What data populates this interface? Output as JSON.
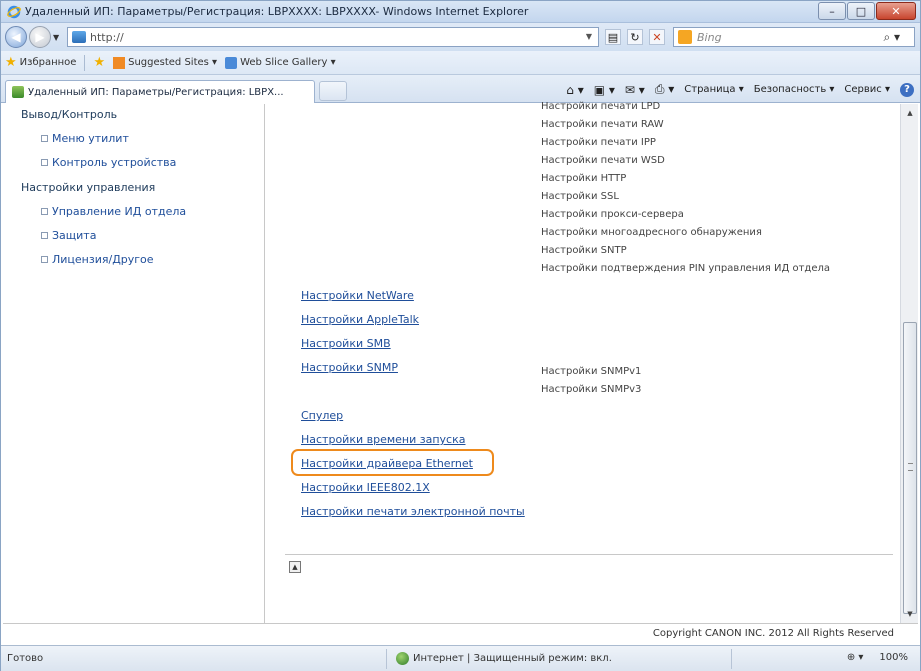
{
  "window": {
    "title": "Удаленный ИП: Параметры/Регистрация: LBPXXXX: LBPXXXX- Windows Internet Explorer",
    "min_label": "–",
    "max_label": "□",
    "close_label": "✕"
  },
  "address": {
    "url": "http://",
    "search_placeholder": "Bing"
  },
  "favorites": {
    "label": "Избранное",
    "items": [
      "Suggested Sites ▾",
      "Web Slice Gallery ▾"
    ]
  },
  "tab": {
    "title": "Удаленный ИП: Параметры/Регистрация: LBPX..."
  },
  "commandbar": {
    "page": "Страница ▾",
    "safety": "Безопасность ▾",
    "tools": "Сервис ▾"
  },
  "sidebar": {
    "section1": "Вывод/Контроль",
    "items1": [
      "Меню утилит",
      "Контроль устройства"
    ],
    "section2": "Настройки управления",
    "items2": [
      "Управление ИД отдела",
      "Защита",
      "Лицензия/Другое"
    ]
  },
  "main": {
    "sub_top": [
      "Настройки печати LPD",
      "Настройки печати RAW",
      "Настройки печати IPP",
      "Настройки печати WSD",
      "Настройки HTTP",
      "Настройки SSL",
      "Настройки прокси-сервера",
      "Настройки многоадресного обнаружения",
      "Настройки SNTP",
      "Настройки подтверждения PIN управления ИД отдела"
    ],
    "links": [
      "Настройки NetWare",
      "Настройки AppleTalk",
      "Настройки SMB",
      "Настройки SNMP",
      "Спулер",
      "Настройки времени запуска",
      "Настройки драйвера Ethernet",
      "Настройки IEEE802.1X",
      "Настройки печати электронной почты"
    ],
    "snmp_sub": [
      "Настройки SNMPv1",
      "Настройки SNMPv3"
    ],
    "copyright": "Copyright CANON INC. 2012 All Rights Reserved"
  },
  "status": {
    "ready": "Готово",
    "zone": "Интернет | Защищенный режим: вкл.",
    "security_icon": "⊕ ▾",
    "zoom": "100%"
  }
}
